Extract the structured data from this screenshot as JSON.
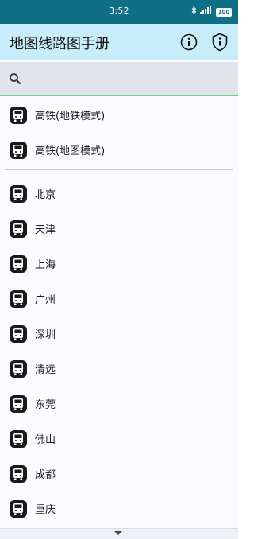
{
  "status_bar": {
    "time": "3:52",
    "icons": [
      "bluetooth-icon",
      "signal-icon",
      "battery-icon"
    ],
    "battery_text": "100"
  },
  "app_bar": {
    "title": "地图线路图手册",
    "actions": [
      "info-icon",
      "privacy-shield-icon"
    ]
  },
  "search": {
    "placeholder": "",
    "value": "",
    "icon": "search-icon"
  },
  "top_items": [
    {
      "label": "高铁(地铁模式)",
      "icon": "train-icon"
    },
    {
      "label": "高铁(地图模式)",
      "icon": "train-icon"
    }
  ],
  "city_items": [
    {
      "label": "北京",
      "icon": "train-icon"
    },
    {
      "label": "天津",
      "icon": "train-icon"
    },
    {
      "label": "上海",
      "icon": "train-icon"
    },
    {
      "label": "广州",
      "icon": "train-icon"
    },
    {
      "label": "深圳",
      "icon": "train-icon"
    },
    {
      "label": "清远",
      "icon": "train-icon"
    },
    {
      "label": "东莞",
      "icon": "train-icon"
    },
    {
      "label": "佛山",
      "icon": "train-icon"
    },
    {
      "label": "成都",
      "icon": "train-icon"
    },
    {
      "label": "重庆",
      "icon": "train-icon"
    }
  ],
  "colors": {
    "status_bar": "#0f6f86",
    "app_bar": "#c9ecfb",
    "search_bar": "#e1e4ec",
    "search_underline": "#6fd07a",
    "icon_fill": "#1a1a1a"
  }
}
